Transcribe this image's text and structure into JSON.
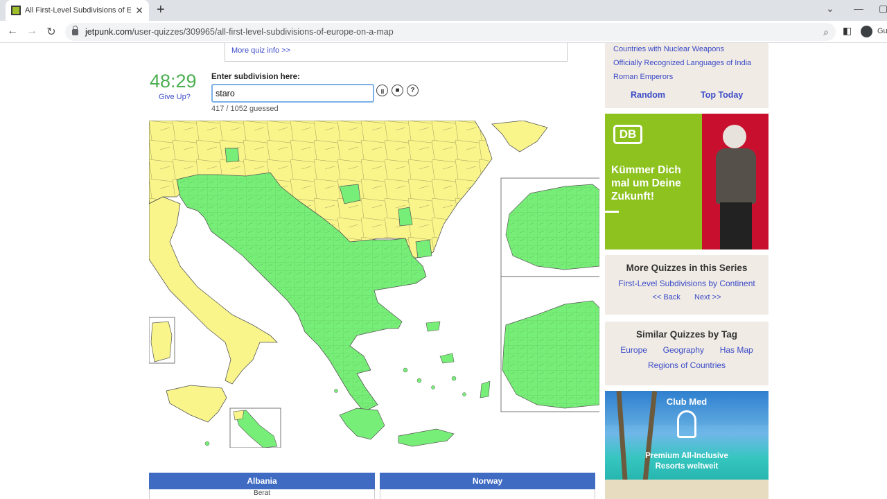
{
  "browser": {
    "tab_title": "All First-Level Subdivisions of Eu",
    "new_tab": "+",
    "url_host": "jetpunk.com",
    "url_path": "/user-quizzes/309965/all-first-level-subdivisions-of-europe-on-a-map",
    "profile_label": "Gu"
  },
  "quiz": {
    "more_info": "More quiz info >>",
    "timer": "48:29",
    "give_up": "Give Up?",
    "enter_label": "Enter subdivision here:",
    "answer_value": "staro",
    "guessed": "417 / 1052 guessed"
  },
  "map": {
    "guessed_color": "#77ee77",
    "unguessed_color": "#f9f58b",
    "border_color": "#555555"
  },
  "tables": [
    {
      "header": "Albania",
      "first_row": "Berat"
    },
    {
      "header": "Norway",
      "first_row": ""
    }
  ],
  "sidebar": {
    "top_links": [
      "Countries with Nuclear Weapons",
      "Officially Recognized Languages of India",
      "Roman Emperors"
    ],
    "random": "Random",
    "top_today": "Top Today",
    "ad1": {
      "logo": "DB",
      "text_lines": [
        "Kümmer Dich",
        "mal um Deine",
        "Zukunft!"
      ],
      "green": "#8dc21f",
      "red": "#c8102e"
    },
    "series": {
      "title": "More Quizzes in this Series",
      "link": "First-Level Subdivisions by Continent",
      "back": "<< Back",
      "next": "Next >>"
    },
    "tags": {
      "title": "Similar Quizzes by Tag",
      "items": [
        "Europe",
        "Geography",
        "Has Map",
        "Regions of Countries"
      ]
    },
    "ad2": {
      "brand": "Club Med",
      "line1": "Premium All-Inclusive",
      "line2": "Resorts weltweit"
    }
  }
}
